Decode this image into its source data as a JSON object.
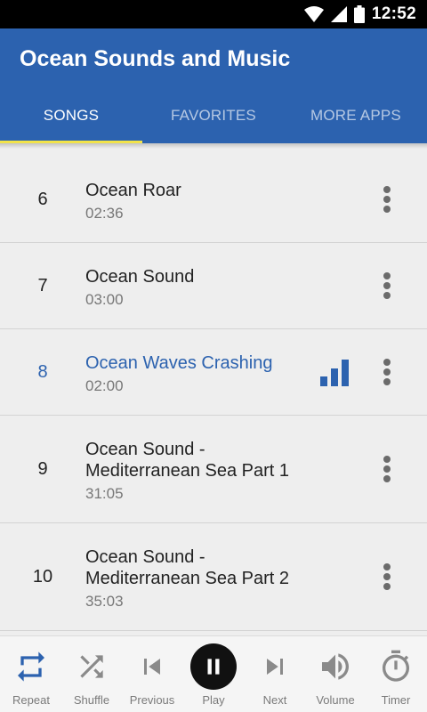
{
  "status_bar": {
    "time": "12:52"
  },
  "app": {
    "title": "Ocean Sounds and Music"
  },
  "tabs": [
    {
      "label": "SONGS",
      "active": true
    },
    {
      "label": "FAVORITES",
      "active": false
    },
    {
      "label": "MORE APPS",
      "active": false
    }
  ],
  "songs": [
    {
      "number": "6",
      "title": "Ocean Roar",
      "duration": "02:36"
    },
    {
      "number": "7",
      "title": "Ocean Sound",
      "duration": "03:00"
    },
    {
      "number": "8",
      "title": "Ocean Waves Crashing",
      "duration": "02:00",
      "playing": true
    },
    {
      "number": "9",
      "title": "Ocean Sound - Mediterranean Sea Part 1",
      "duration": "31:05"
    },
    {
      "number": "10",
      "title": "Ocean Sound - Mediterranean Sea Part 2",
      "duration": "35:03"
    }
  ],
  "controls": {
    "repeat": "Repeat",
    "shuffle": "Shuffle",
    "previous": "Previous",
    "play": "Play",
    "next": "Next",
    "volume": "Volume",
    "timer": "Timer"
  },
  "colors": {
    "primary": "#2c62af",
    "tab_indicator": "#f2e34a",
    "inactive_control": "#8a8a8a"
  }
}
